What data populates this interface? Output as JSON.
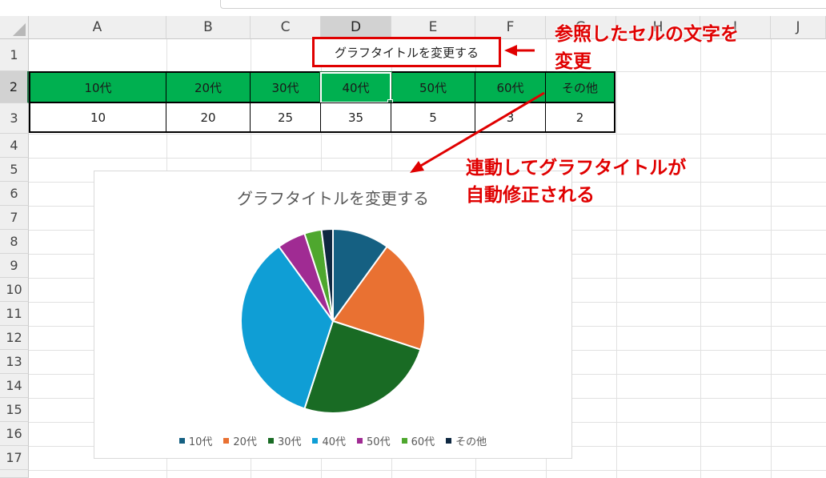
{
  "columns": [
    "A",
    "B",
    "C",
    "D",
    "E",
    "F",
    "G",
    "H",
    "I",
    "J"
  ],
  "rows": [
    "1",
    "2",
    "3",
    "4",
    "5",
    "6",
    "7",
    "8",
    "9",
    "10",
    "11",
    "12",
    "13",
    "14",
    "15",
    "16",
    "17"
  ],
  "selected_column": "D",
  "selected_row": "2",
  "title_cell": "グラフタイトルを変更する",
  "header_row": [
    "10代",
    "20代",
    "30代",
    "40代",
    "50代",
    "60代",
    "その他"
  ],
  "value_row": [
    "10",
    "20",
    "25",
    "35",
    "5",
    "3",
    "2"
  ],
  "annotations": {
    "top": [
      "参照したセルの文字を",
      "変更"
    ],
    "middle": [
      "連動してグラフタイトルが",
      "自動修正される"
    ],
    "color": "#e00000"
  },
  "chart_data": {
    "type": "pie",
    "title": "グラフタイトルを変更する",
    "categories": [
      "10代",
      "20代",
      "30代",
      "40代",
      "50代",
      "60代",
      "その他"
    ],
    "values": [
      10,
      20,
      25,
      35,
      5,
      3,
      2
    ],
    "colors": [
      "#156082",
      "#e97132",
      "#196b24",
      "#0f9ed5",
      "#a02b93",
      "#4ea72e",
      "#0e2841"
    ],
    "legend": "bottom"
  }
}
